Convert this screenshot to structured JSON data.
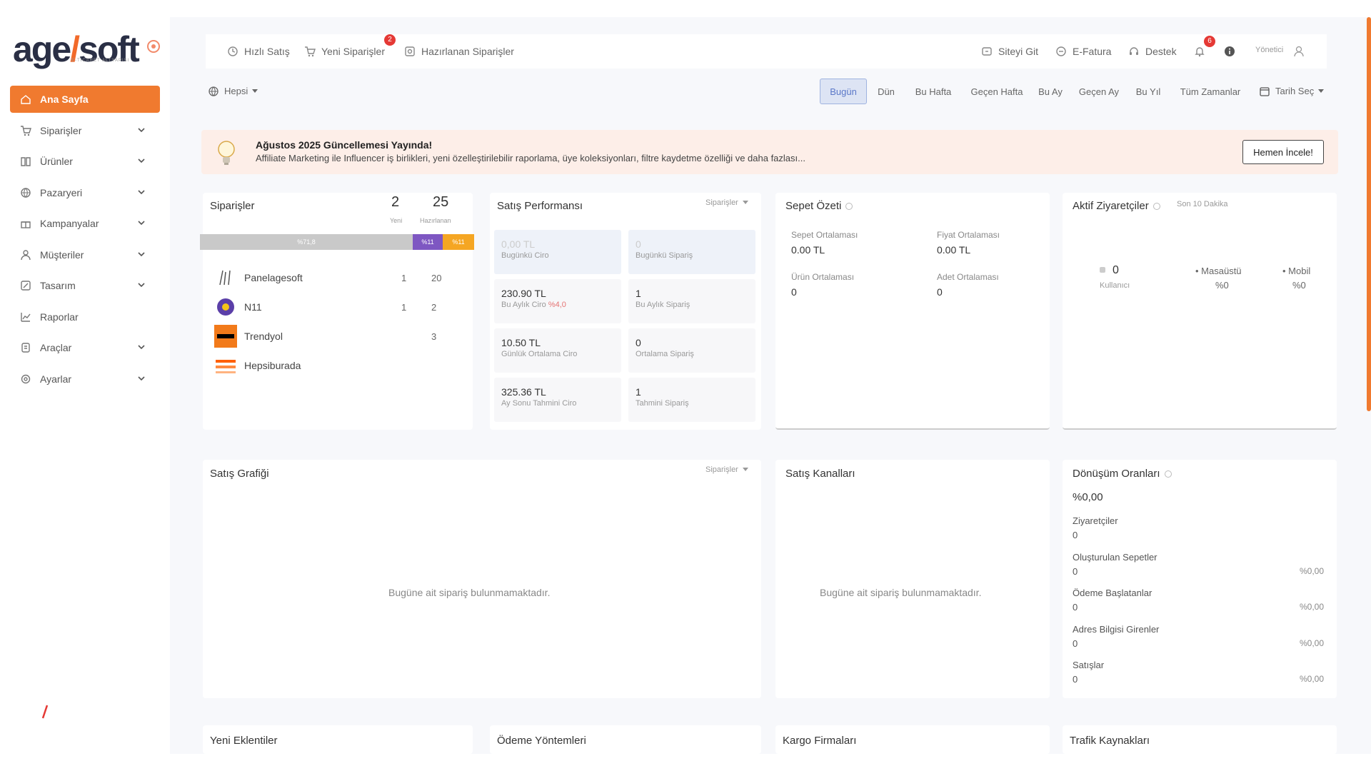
{
  "brand": {
    "name_part1": "age",
    "name_part2": "soft",
    "subtitle": "E-TİCARET ALTYAPISI",
    "accent": "#f07a2f"
  },
  "sidebar": {
    "items": [
      {
        "label": "Ana Sayfa",
        "icon": "home-icon",
        "active": true,
        "has_chevron": false
      },
      {
        "label": "Siparişler",
        "icon": "cart-icon",
        "has_chevron": true
      },
      {
        "label": "Ürünler",
        "icon": "book-icon",
        "has_chevron": true
      },
      {
        "label": "Pazaryeri",
        "icon": "globe-icon",
        "has_chevron": true
      },
      {
        "label": "Kampanyalar",
        "icon": "gift-icon",
        "has_chevron": true
      },
      {
        "label": "Müşteriler",
        "icon": "user-icon",
        "has_chevron": true
      },
      {
        "label": "Tasarım",
        "icon": "edit-icon",
        "has_chevron": true
      },
      {
        "label": "Raporlar",
        "icon": "chart-icon",
        "has_chevron": false
      },
      {
        "label": "Araçlar",
        "icon": "tool-icon",
        "has_chevron": true
      },
      {
        "label": "Ayarlar",
        "icon": "settings-icon",
        "has_chevron": true
      }
    ]
  },
  "topbar": {
    "quick_sale": "Hızlı Satış",
    "new_orders": "Yeni Siparişler",
    "new_orders_badge": "2",
    "prepared_orders": "Hazırlanan Siparişler",
    "go_site": "Siteyi Git",
    "e_invoice": "E-Fatura",
    "support": "Destek",
    "notif_badge": "6",
    "user_label": "Yönetici"
  },
  "filter": {
    "scope": "Hepsi",
    "date_tabs": [
      "Bugün",
      "Dün",
      "Bu Hafta",
      "Geçen Hafta",
      "Bu Ay",
      "Geçen Ay",
      "Bu Yıl",
      "Tüm Zamanlar"
    ],
    "active_tab": "Bugün",
    "date_pick": "Tarih Seç"
  },
  "banner": {
    "title": "Ağustos 2025 Güncellemesi Yayında!",
    "text": "Affiliate Marketing ile Influencer iş birlikleri, yeni özelleştirilebilir raporlama, üye koleksiyonları, filtre kaydetme özelliği ve daha fazlası...",
    "button": "Hemen İncele!"
  },
  "orders_card": {
    "title": "Siparişler",
    "count_new": "2",
    "count_new_label": "Yeni",
    "count_prep": "25",
    "count_prep_label": "Hazırlanan",
    "bar_segments": [
      "%71,8",
      "%11",
      "%11"
    ],
    "marketplaces": [
      {
        "name": "Panelagesoft",
        "new": "1",
        "prep": "20",
        "logo_color": "#ffffff"
      },
      {
        "name": "N11",
        "new": "1",
        "prep": "2",
        "logo_color": "#5b3fa8"
      },
      {
        "name": "Trendyol",
        "new": "",
        "prep": "3",
        "logo_color": "#f27a1a"
      },
      {
        "name": "Hepsiburada",
        "new": "",
        "prep": "",
        "logo_color": "#ff6000"
      }
    ]
  },
  "sales_perf": {
    "title": "Satış Performansı",
    "dropdown": "Siparişler",
    "cells": [
      {
        "value": "0,00 TL",
        "label": "Bugünkü Ciro"
      },
      {
        "value": "0",
        "label": "Bugünkü Sipariş"
      },
      {
        "value": "230.90 TL",
        "label": "Bu Aylık Ciro",
        "delta": "%4,0"
      },
      {
        "value": "1",
        "label": "Bu Aylık Sipariş"
      },
      {
        "value": "10.50 TL",
        "label": "Günlük Ortalama Ciro"
      },
      {
        "value": "0",
        "label": "Ortalama Sipariş"
      },
      {
        "value": "325.36 TL",
        "label": "Ay Sonu Tahmini Ciro"
      },
      {
        "value": "1",
        "label": "Tahmini Sipariş"
      }
    ]
  },
  "cart_summary": {
    "title": "Sepet Özeti",
    "items": [
      {
        "label": "Sepet Ortalaması",
        "value": "0.00 TL"
      },
      {
        "label": "Fiyat Ortalaması",
        "value": "0.00 TL"
      },
      {
        "label": "Ürün Ortalaması",
        "value": "0"
      },
      {
        "label": "Adet Ortalaması",
        "value": "0"
      }
    ]
  },
  "visitors": {
    "title": "Aktif Ziyaretçiler",
    "tag": "Son 10 Dakika",
    "count": "0",
    "count_label": "Kullanıcı",
    "desktop_label": "Masaüstü",
    "desktop_value": "%0",
    "mobile_label": "Mobil",
    "mobile_value": "%0"
  },
  "sales_chart": {
    "title": "Satış Grafiği",
    "dropdown": "Siparişler",
    "empty": "Bugüne ait sipariş bulunmamaktadır."
  },
  "sales_channels": {
    "title": "Satış Kanalları",
    "empty": "Bugüne ait sipariş bulunmamaktadır."
  },
  "conversion": {
    "title": "Dönüşüm Oranları",
    "total": "%0,00",
    "rows": [
      {
        "label": "Ziyaretçiler",
        "value": "0",
        "pct": ""
      },
      {
        "label": "Oluşturulan Sepetler",
        "value": "0",
        "pct": "%0,00"
      },
      {
        "label": "Ödeme Başlatanlar",
        "value": "0",
        "pct": "%0,00"
      },
      {
        "label": "Adres Bilgisi Girenler",
        "value": "0",
        "pct": "%0,00"
      },
      {
        "label": "Satışlar",
        "value": "0",
        "pct": "%0,00"
      }
    ]
  },
  "bottom_cards": [
    "Yeni Eklentiler",
    "Ödeme Yöntemleri",
    "Kargo Firmaları",
    "Trafik Kaynakları"
  ]
}
